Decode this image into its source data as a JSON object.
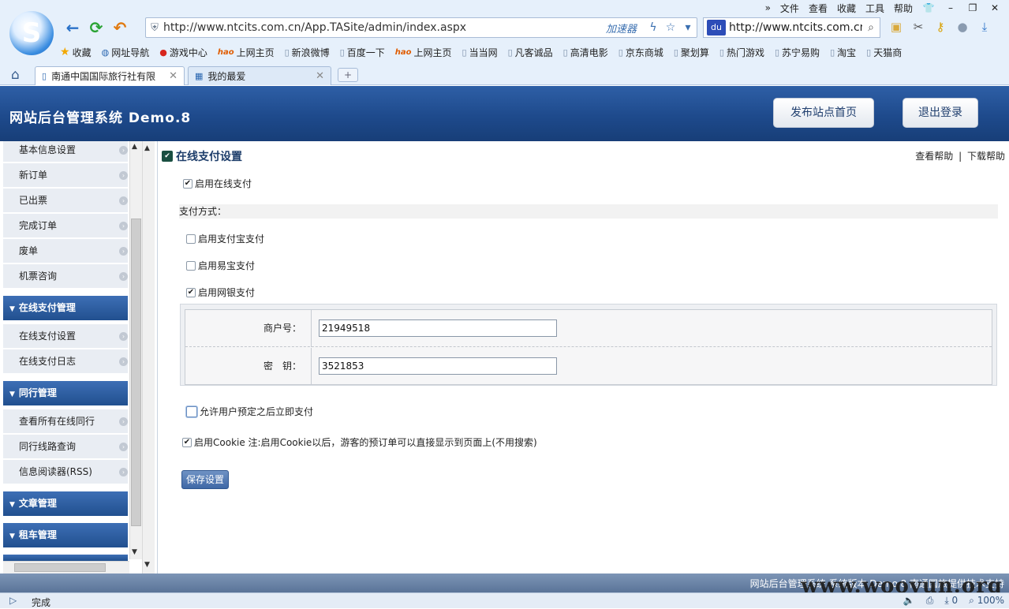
{
  "browser": {
    "menu": [
      "文件",
      "查看",
      "收藏",
      "工具",
      "帮助"
    ],
    "menu_prefix": "»",
    "address_url": "http://www.ntcits.com.cn/App.TASite/admin/index.aspx",
    "accelerator_label": "加速器",
    "search_value": "http://www.ntcits.com.cn/",
    "favorites": [
      {
        "label": "收藏",
        "icon": "star-icon"
      },
      {
        "label": "网址导航",
        "icon": "globe-icon"
      },
      {
        "label": "游戏中心",
        "icon": "game-icon"
      },
      {
        "label": "上网主页",
        "icon": "hao-icon"
      },
      {
        "label": "新浪微博",
        "icon": "page-icon"
      },
      {
        "label": "百度一下",
        "icon": "page-icon"
      },
      {
        "label": "上网主页",
        "icon": "hao-icon"
      },
      {
        "label": "当当网",
        "icon": "page-icon"
      },
      {
        "label": "凡客诚品",
        "icon": "page-icon"
      },
      {
        "label": "高清电影",
        "icon": "page-icon"
      },
      {
        "label": "京东商城",
        "icon": "page-icon"
      },
      {
        "label": "聚划算",
        "icon": "page-icon"
      },
      {
        "label": "热门游戏",
        "icon": "page-icon"
      },
      {
        "label": "苏宁易购",
        "icon": "page-icon"
      },
      {
        "label": "淘宝",
        "icon": "page-icon"
      },
      {
        "label": "天猫商",
        "icon": "page-icon"
      }
    ],
    "tabs": [
      {
        "label": "南通中国国际旅行社有限"
      },
      {
        "label": "我的最爱"
      }
    ],
    "new_tab": "+",
    "status_text": "完成",
    "status_count": "0",
    "zoom": "100%"
  },
  "header": {
    "title": "网站后台管理系统  Demo.8",
    "publish_button": "发布站点首页",
    "logout_button": "退出登录"
  },
  "sidebar": {
    "top_items": [
      "基本信息设置",
      "新订单",
      "已出票",
      "完成订单",
      "废单",
      "机票咨询"
    ],
    "groups": [
      {
        "label": "在线支付管理",
        "items": [
          "在线支付设置",
          "在线支付日志"
        ]
      },
      {
        "label": "同行管理",
        "items": [
          "查看所有在线同行",
          "同行线路查询",
          "信息阅读器(RSS)"
        ]
      },
      {
        "label": "文章管理",
        "items": []
      },
      {
        "label": "租车管理",
        "items": []
      }
    ]
  },
  "main": {
    "section_title": "在线支付设置",
    "help_link": "查看帮助",
    "help_separator": "|",
    "download_link": "下载帮助",
    "enable_online_pay": {
      "label": "启用在线支付",
      "checked": true
    },
    "pay_methods_label": "支付方式：",
    "methods": [
      {
        "label": "启用支付宝支付",
        "checked": false
      },
      {
        "label": "启用易宝支付",
        "checked": false
      },
      {
        "label": "启用网银支付",
        "checked": true
      }
    ],
    "merchant_label": "商户号：",
    "merchant_value": "21949518",
    "key_label": "密　钥：",
    "key_value": "3521853",
    "instant_pay": {
      "label": "允许用户预定之后立即支付",
      "checked": false
    },
    "cookie": {
      "label": "启用Cookie  注:启用Cookie以后，游客的预订单可以直接显示到页面上(不用搜索)",
      "checked": true
    },
    "save_button": "保存设置"
  },
  "footer": {
    "text": "网站后台管理系统  系统版本  Demo.8  南通国旅提供技术支持",
    "watermark": "www.wooyun.org"
  }
}
